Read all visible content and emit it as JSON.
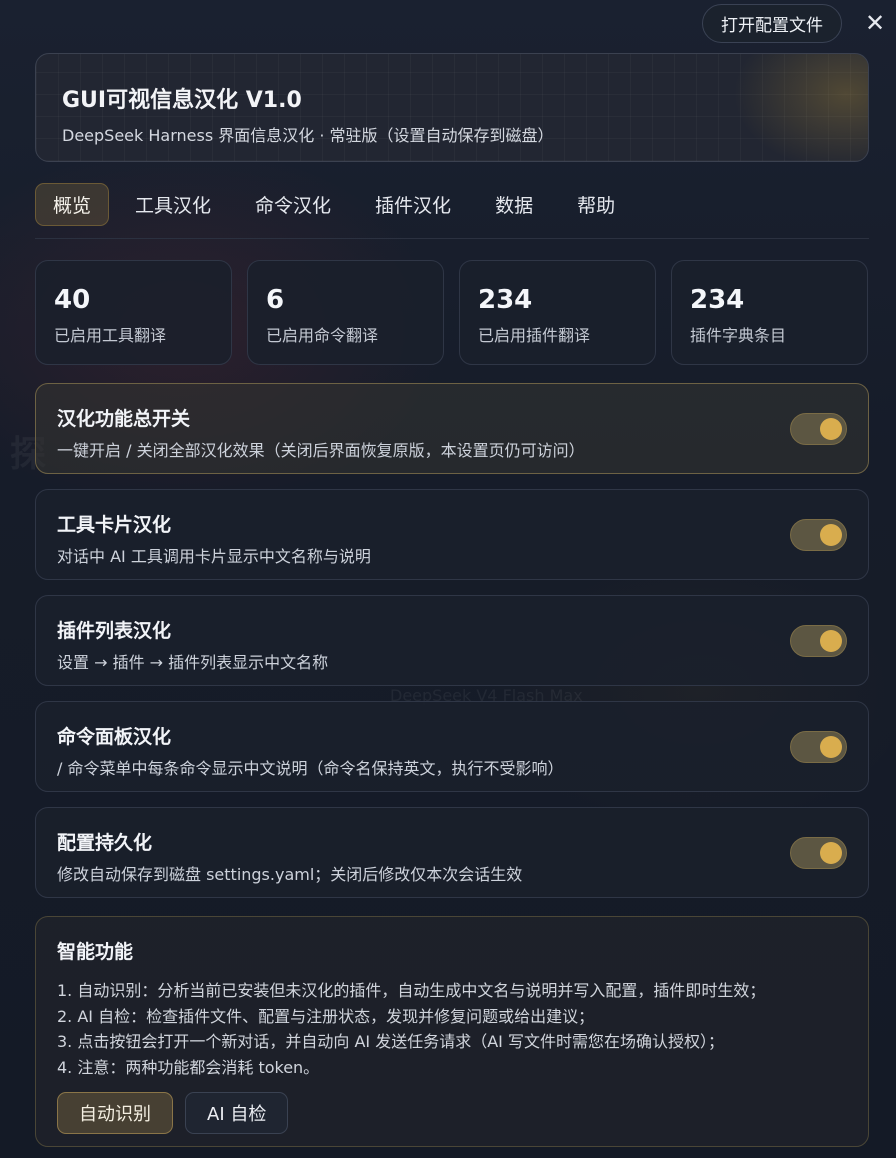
{
  "topbar": {
    "open_config_label": "打开配置文件",
    "close_symbol": "✕"
  },
  "header": {
    "title": "GUI可视信息汉化 V1.0",
    "subtitle": "DeepSeek Harness 界面信息汉化 · 常驻版（设置自动保存到磁盘）"
  },
  "tabs": [
    {
      "label": "概览",
      "active": true
    },
    {
      "label": "工具汉化",
      "active": false
    },
    {
      "label": "命令汉化",
      "active": false
    },
    {
      "label": "插件汉化",
      "active": false
    },
    {
      "label": "数据",
      "active": false
    },
    {
      "label": "帮助",
      "active": false
    }
  ],
  "stats": [
    {
      "value": "40",
      "label": "已启用工具翻译"
    },
    {
      "value": "6",
      "label": "已启用命令翻译"
    },
    {
      "value": "234",
      "label": "已启用插件翻译"
    },
    {
      "value": "234",
      "label": "插件字典条目"
    }
  ],
  "settings": [
    {
      "title": "汉化功能总开关",
      "desc": "一键开启 / 关闭全部汉化效果（关闭后界面恢复原版，本设置页仍可访问）",
      "enabled": true
    },
    {
      "title": "工具卡片汉化",
      "desc": "对话中 AI 工具调用卡片显示中文名称与说明",
      "enabled": true
    },
    {
      "title": "插件列表汉化",
      "desc": "设置 → 插件 → 插件列表显示中文名称",
      "enabled": true
    },
    {
      "title": "命令面板汉化",
      "desc": "/ 命令菜单中每条命令显示中文说明（命令名保持英文，执行不受影响）",
      "enabled": true
    },
    {
      "title": "配置持久化",
      "desc": "修改自动保存到磁盘 settings.yaml；关闭后修改仅本次会话生效",
      "enabled": true
    }
  ],
  "smart": {
    "title": "智能功能",
    "lines": [
      "1. 自动识别：分析当前已安装但未汉化的插件，自动生成中文名与说明并写入配置，插件即时生效；",
      "2. AI 自检：检查插件文件、配置与注册状态，发现并修复问题或给出建议；",
      "3. 点击按钮会打开一个新对话，并自动向 AI 发送任务请求（AI 写文件时需您在场确认授权）；",
      "4. 注意：两种功能都会消耗 token。"
    ],
    "auto_detect_label": "自动识别",
    "ai_check_label": "AI 自检"
  },
  "background": {
    "ghost_text": "探",
    "ghost_model": "DeepSeek V4 Flash Max"
  },
  "colors": {
    "accent": "#d9ad4e",
    "panel": "#1a202c",
    "page_bg": "#141a26"
  }
}
